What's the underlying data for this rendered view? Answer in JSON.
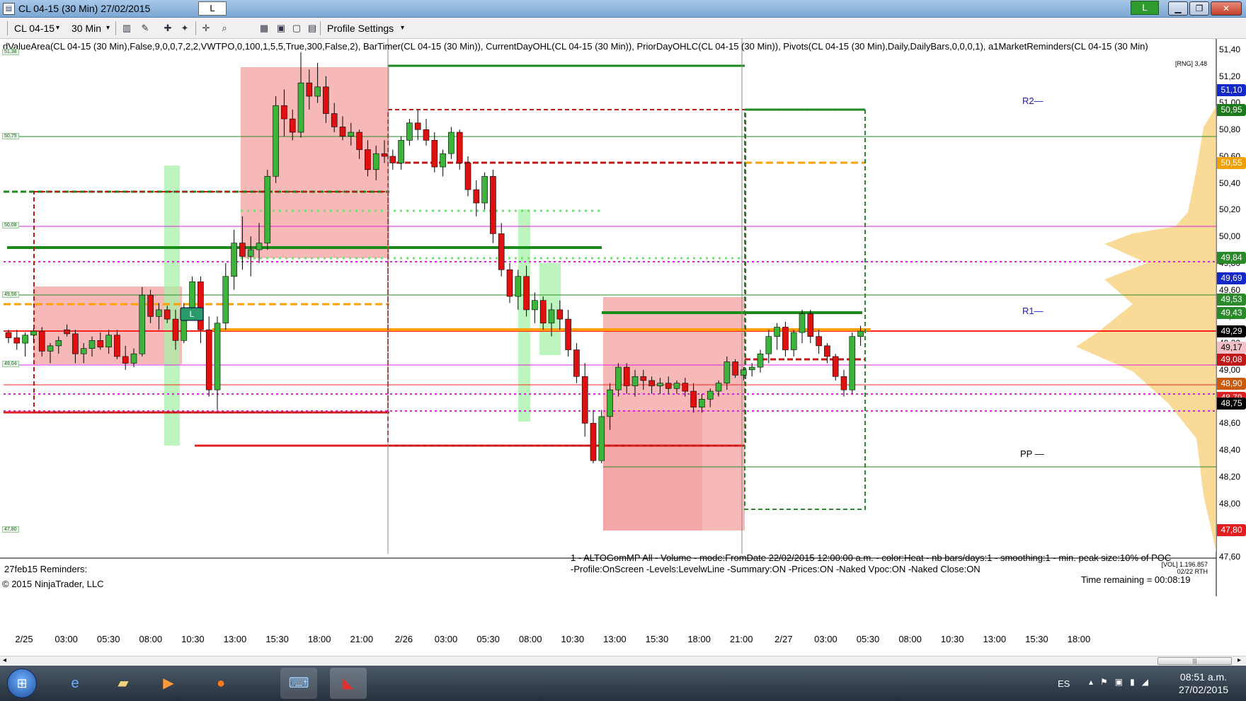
{
  "window": {
    "title": "CL 04-15 (30 Min)  27/02/2015",
    "center_button": "L",
    "right_button": "L",
    "minimize": "▁",
    "maximize": "❐",
    "close": "✕"
  },
  "toolbar": {
    "instrument": "CL 04-15",
    "period": "30 Min",
    "profile_settings": "Profile Settings",
    "dropdown_arrow": "▾"
  },
  "indicators_text": "dValueArea(CL 04-15 (30 Min),False,9,0,0,7,2,2,VWTPO,0,100,1,5,5,True,300,False,2),  BarTimer(CL 04-15 (30 Min)),  CurrentDayOHL(CL 04-15 (30 Min)),  PriorDayOHLC(CL 04-15 (30 Min)),  Pivots(CL 04-15 (30 Min),Daily,DailyBars,0,0,0,1),  a1MarketReminders(CL 04-15 (30 Min)",
  "rng_info": "[RNG] 3,48",
  "price_axis": {
    "ticks": [
      "51,40",
      "51,20",
      "51,00",
      "50,80",
      "50,60",
      "50,40",
      "50,20",
      "50,00",
      "49,80",
      "49,60",
      "49,40",
      "49,20",
      "49,00",
      "48,80",
      "48,60",
      "48,40",
      "48,20",
      "48,00",
      "47,80",
      "47,60"
    ],
    "left_small_labels": [
      "51,38",
      "50,75",
      "50,08",
      "49,56",
      "49,04",
      "47,80"
    ]
  },
  "price_labels": [
    {
      "text": "51,10",
      "color": "#1428c8"
    },
    {
      "text": "50,95",
      "color": "#1c7a1c"
    },
    {
      "text": "50,55",
      "color": "#f0a000"
    },
    {
      "text": "49,84",
      "color": "#2a8a2a"
    },
    {
      "text": "49,69",
      "color": "#1428c8"
    },
    {
      "text": "49,53",
      "color": "#2a8a2a"
    },
    {
      "text": "49,43",
      "color": "#2a8a2a"
    },
    {
      "text": "49,29",
      "color": "#000000"
    },
    {
      "text": "49,17",
      "color": "#f4c0c8"
    },
    {
      "text": "49,08",
      "color": "#c01818"
    },
    {
      "text": "48,90",
      "color": "#c85a0a"
    },
    {
      "text": "48,79",
      "color": "#e02020"
    },
    {
      "text": "48,75",
      "color": "#000000"
    },
    {
      "text": "47,80",
      "color": "#e02020"
    }
  ],
  "pivots": {
    "r2": "R2—",
    "r1": "R1—",
    "pp": "PP —"
  },
  "time_axis": [
    "2/25",
    "03:00",
    "05:30",
    "08:00",
    "10:30",
    "13:00",
    "15:30",
    "18:00",
    "21:00",
    "2/26",
    "03:00",
    "05:30",
    "08:00",
    "10:30",
    "13:00",
    "15:30",
    "18:00",
    "21:00",
    "2/27",
    "03:00",
    "05:30",
    "08:00",
    "10:30",
    "13:00",
    "15:30",
    "18:00"
  ],
  "annotations": {
    "gom_line1": "1 - ALTOGomMP  All - Volume - mode:FromDate 22/02/2015 12:00:00 a.m.  - color:Heat - nb bars/days:1 - smoothing:1 - min. peak size:10% of POC",
    "gom_line2": "-Profile:OnScreen -Levels:LevelwLine -Summary:ON -Prices:ON -Naked Vpoc:ON -Naked Close:ON",
    "reminders": "27feb15 Reminders:",
    "copyright": "© 2015 NinjaTrader, LLC",
    "time_remaining": "Time remaining = 00:08:19",
    "vol_line1": "[VOL] 1.196.857",
    "vol_line2": "02/22 RTH",
    "entry_marker": "L"
  },
  "taskbar": {
    "lang": "ES",
    "time": "08:51 a.m.",
    "date": "27/02/2015"
  },
  "colors": {
    "bull": "#3cb43c",
    "bear": "#e01010",
    "value_area_red": "#f4a0a0",
    "value_area_green": "#a8f0a8",
    "pivot_blue": "#1a1acc",
    "poc_orange": "#ffa000",
    "magenta": "#e020e0"
  },
  "chart_data": {
    "type": "candlestick",
    "y_range": [
      47.6,
      51.45
    ],
    "x_labels": [
      "2/25",
      "03:00",
      "05:30",
      "08:00",
      "10:30",
      "13:00",
      "15:30",
      "18:00",
      "21:00",
      "2/26",
      "03:00",
      "05:30",
      "08:00",
      "10:30",
      "13:00",
      "15:30",
      "18:00",
      "21:00",
      "2/27",
      "03:00",
      "05:30",
      "08:00",
      "10:30",
      "13:00",
      "15:30",
      "18:00"
    ],
    "candles": [
      [
        49.28,
        49.3,
        49.2,
        49.24
      ],
      [
        49.24,
        49.3,
        49.15,
        49.2
      ],
      [
        49.2,
        49.28,
        49.1,
        49.26
      ],
      [
        49.26,
        49.31,
        49.2,
        49.29
      ],
      [
        49.29,
        49.32,
        49.1,
        49.14
      ],
      [
        49.14,
        49.2,
        49.05,
        49.18
      ],
      [
        49.18,
        49.25,
        49.12,
        49.22
      ],
      [
        49.3,
        49.34,
        49.25,
        49.27
      ],
      [
        49.27,
        49.3,
        49.05,
        49.12
      ],
      [
        49.12,
        49.2,
        49.05,
        49.16
      ],
      [
        49.16,
        49.25,
        49.1,
        49.22
      ],
      [
        49.22,
        49.28,
        49.15,
        49.17
      ],
      [
        49.17,
        49.3,
        49.12,
        49.26
      ],
      [
        49.26,
        49.3,
        49.08,
        49.1
      ],
      [
        49.1,
        49.18,
        49.0,
        49.05
      ],
      [
        49.05,
        49.16,
        49.02,
        49.12
      ],
      [
        49.12,
        49.62,
        49.1,
        49.56
      ],
      [
        49.56,
        49.6,
        49.35,
        49.4
      ],
      [
        49.4,
        49.5,
        49.3,
        49.45
      ],
      [
        49.45,
        49.48,
        49.35,
        49.38
      ],
      [
        49.38,
        49.45,
        49.15,
        49.22
      ],
      [
        49.22,
        49.5,
        49.2,
        49.42
      ],
      [
        49.42,
        49.7,
        49.4,
        49.66
      ],
      [
        49.66,
        49.7,
        49.2,
        49.3
      ],
      [
        49.3,
        49.4,
        48.8,
        48.85
      ],
      [
        48.85,
        49.4,
        48.7,
        49.35
      ],
      [
        49.35,
        49.8,
        49.3,
        49.7
      ],
      [
        49.7,
        50.05,
        49.6,
        49.95
      ],
      [
        49.95,
        50.15,
        49.75,
        49.85
      ],
      [
        49.85,
        50.0,
        49.7,
        49.9
      ],
      [
        49.9,
        50.1,
        49.8,
        49.95
      ],
      [
        49.95,
        50.5,
        49.9,
        50.45
      ],
      [
        50.45,
        51.05,
        50.4,
        50.98
      ],
      [
        50.98,
        51.1,
        50.75,
        50.88
      ],
      [
        50.88,
        50.95,
        50.72,
        50.78
      ],
      [
        50.78,
        51.38,
        50.74,
        51.15
      ],
      [
        51.15,
        51.25,
        50.95,
        51.05
      ],
      [
        51.05,
        51.3,
        51.0,
        51.12
      ],
      [
        51.12,
        51.2,
        50.85,
        50.92
      ],
      [
        50.92,
        51.0,
        50.78,
        50.82
      ],
      [
        50.82,
        50.9,
        50.72,
        50.75
      ],
      [
        50.75,
        50.85,
        50.68,
        50.78
      ],
      [
        50.78,
        50.8,
        50.58,
        50.65
      ],
      [
        50.65,
        50.72,
        50.45,
        50.5
      ],
      [
        50.5,
        50.68,
        50.42,
        50.62
      ],
      [
        50.62,
        50.72,
        50.55,
        50.6
      ],
      [
        50.6,
        50.65,
        50.5,
        50.55
      ],
      [
        50.55,
        50.75,
        50.5,
        50.72
      ],
      [
        50.72,
        50.88,
        50.68,
        50.85
      ],
      [
        50.85,
        50.95,
        50.72,
        50.8
      ],
      [
        50.8,
        50.88,
        50.68,
        50.72
      ],
      [
        50.72,
        50.78,
        50.48,
        50.52
      ],
      [
        50.52,
        50.65,
        50.45,
        50.62
      ],
      [
        50.62,
        50.82,
        50.58,
        50.78
      ],
      [
        50.78,
        50.8,
        50.5,
        50.55
      ],
      [
        50.55,
        50.6,
        50.3,
        50.35
      ],
      [
        50.35,
        50.42,
        50.15,
        50.25
      ],
      [
        50.25,
        50.48,
        50.2,
        50.45
      ],
      [
        50.45,
        50.5,
        49.95,
        50.02
      ],
      [
        50.02,
        50.1,
        49.7,
        49.75
      ],
      [
        49.75,
        49.8,
        49.5,
        49.55
      ],
      [
        49.55,
        49.75,
        49.45,
        49.7
      ],
      [
        49.7,
        49.78,
        49.4,
        49.45
      ],
      [
        49.45,
        49.58,
        49.35,
        49.52
      ],
      [
        49.52,
        49.55,
        49.3,
        49.35
      ],
      [
        49.35,
        49.5,
        49.25,
        49.45
      ],
      [
        49.45,
        49.52,
        49.3,
        49.38
      ],
      [
        49.38,
        49.45,
        49.1,
        49.15
      ],
      [
        49.15,
        49.2,
        48.9,
        48.95
      ],
      [
        48.95,
        49.05,
        48.5,
        48.6
      ],
      [
        48.6,
        48.7,
        48.3,
        48.32
      ],
      [
        48.32,
        48.7,
        48.3,
        48.65
      ],
      [
        48.65,
        48.9,
        48.55,
        48.85
      ],
      [
        48.85,
        49.05,
        48.8,
        49.02
      ],
      [
        49.02,
        49.05,
        48.82,
        48.88
      ],
      [
        48.88,
        49.0,
        48.8,
        48.95
      ],
      [
        48.95,
        49.0,
        48.85,
        48.92
      ],
      [
        48.92,
        48.95,
        48.82,
        48.88
      ],
      [
        48.88,
        48.94,
        48.82,
        48.9
      ],
      [
        48.9,
        48.95,
        48.82,
        48.86
      ],
      [
        48.86,
        48.92,
        48.82,
        48.9
      ],
      [
        48.9,
        48.94,
        48.8,
        48.84
      ],
      [
        48.84,
        48.9,
        48.68,
        48.72
      ],
      [
        48.72,
        48.82,
        48.68,
        48.78
      ],
      [
        48.78,
        48.86,
        48.72,
        48.84
      ],
      [
        48.84,
        48.92,
        48.8,
        48.9
      ],
      [
        48.9,
        49.1,
        48.85,
        49.06
      ],
      [
        49.06,
        49.08,
        48.94,
        48.96
      ],
      [
        48.96,
        49.02,
        48.92,
        49.0
      ],
      [
        49.0,
        49.05,
        48.95,
        49.02
      ],
      [
        49.02,
        49.15,
        48.98,
        49.12
      ],
      [
        49.12,
        49.3,
        49.05,
        49.25
      ],
      [
        49.25,
        49.35,
        49.15,
        49.32
      ],
      [
        49.32,
        49.36,
        49.1,
        49.15
      ],
      [
        49.15,
        49.3,
        49.1,
        49.28
      ],
      [
        49.28,
        49.45,
        49.2,
        49.42
      ],
      [
        49.42,
        49.45,
        49.2,
        49.25
      ],
      [
        49.25,
        49.3,
        49.12,
        49.18
      ],
      [
        49.18,
        49.2,
        49.05,
        49.1
      ],
      [
        49.1,
        49.12,
        48.92,
        48.95
      ],
      [
        48.95,
        49.0,
        48.8,
        48.85
      ],
      [
        48.85,
        49.28,
        48.82,
        49.25
      ],
      [
        49.25,
        49.33,
        49.18,
        49.29
      ]
    ],
    "levels": [
      {
        "name": "R2",
        "value": 51.1
      },
      {
        "name": "R1",
        "value": 49.69
      },
      {
        "name": "PP",
        "value": 48.75
      },
      {
        "name": "prior-high",
        "value": 50.95
      },
      {
        "name": "naked-vpoc",
        "value": 50.55
      },
      {
        "name": "current-close",
        "value": 49.29
      },
      {
        "name": "low",
        "value": 47.8
      }
    ]
  }
}
